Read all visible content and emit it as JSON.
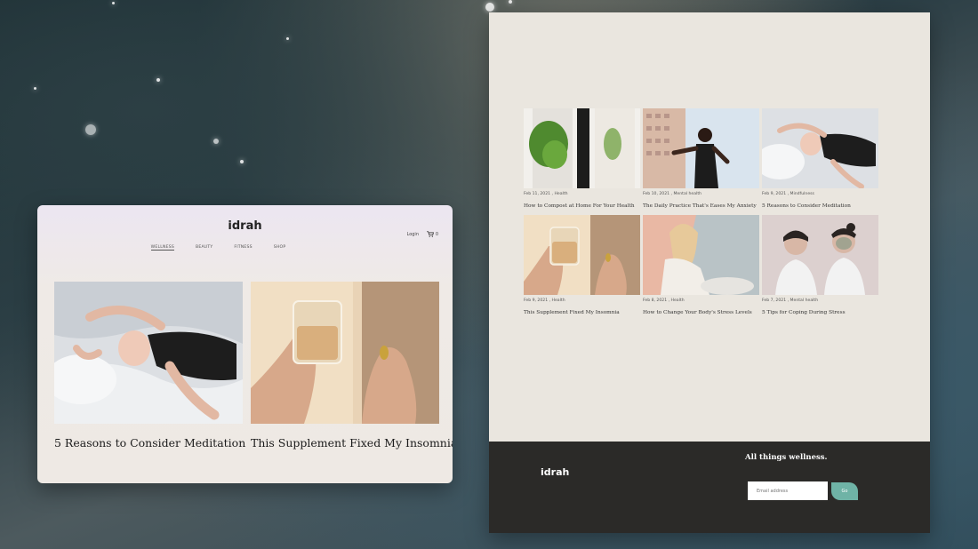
{
  "left_site": {
    "logo": "idrah",
    "login": "Login",
    "cart_count": "0",
    "nav": [
      "WELLNESS",
      "BEAUTY",
      "FITNESS",
      "SHOP"
    ],
    "posts": [
      {
        "title": "5 Reasons to Consider Meditation"
      },
      {
        "title": "This Supplement Fixed My Insomnia"
      }
    ]
  },
  "right_site": {
    "posts": [
      {
        "date": "Feb 11, 2021",
        "category": "Health",
        "title": "How to Compost at Home For Your Health"
      },
      {
        "date": "Feb 10, 2021",
        "category": "Mental health",
        "title": "The Daily Practice That's Eases My Anxiety"
      },
      {
        "date": "Feb 9, 2021",
        "category": "Mindfulness",
        "title": "5 Reasons to Consider Meditation"
      },
      {
        "date": "Feb 9, 2021",
        "category": "Health",
        "title": "This Supplement Fixed My Insomnia"
      },
      {
        "date": "Feb 8, 2021",
        "category": "Health",
        "title": "How to Change Your Body's Stress Levels"
      },
      {
        "date": "Feb 7, 2021",
        "category": "Mental health",
        "title": "5 Tips for Coping During Stress"
      }
    ],
    "footer": {
      "logo": "idrah",
      "tagline": "All things wellness.",
      "email_placeholder": "Email address",
      "go_label": "Go"
    }
  },
  "colors": {
    "accent": "#6fb3a6",
    "footer_bg": "#2b2a28",
    "panel_bg": "#eae6df"
  }
}
